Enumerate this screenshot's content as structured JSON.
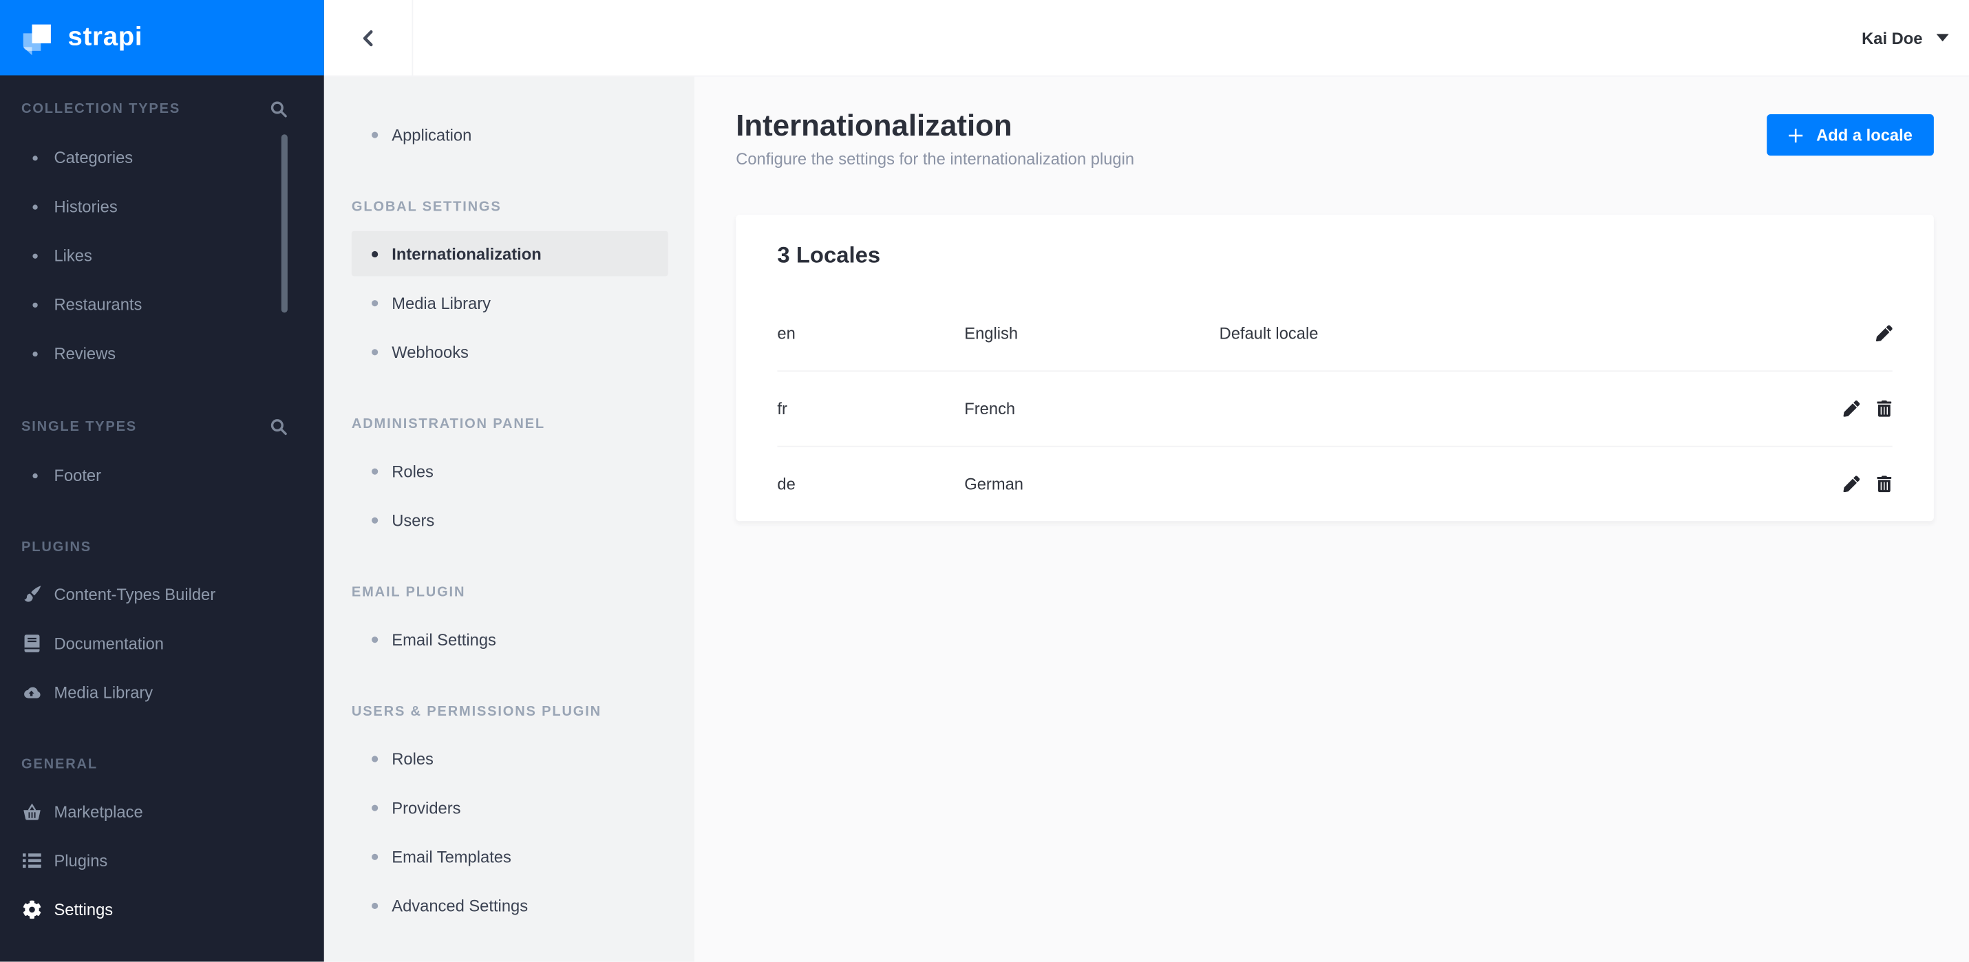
{
  "brand": {
    "logo_text": "strapi",
    "accent_color": "#007eff"
  },
  "main_sidebar": {
    "sections": [
      {
        "label": "COLLECTION TYPES",
        "has_search": true,
        "items": [
          {
            "label": "Categories"
          },
          {
            "label": "Histories"
          },
          {
            "label": "Likes"
          },
          {
            "label": "Restaurants"
          },
          {
            "label": "Reviews"
          }
        ]
      },
      {
        "label": "SINGLE TYPES",
        "has_search": true,
        "items": [
          {
            "label": "Footer"
          }
        ]
      },
      {
        "label": "PLUGINS",
        "items": [
          {
            "label": "Content-Types Builder",
            "icon": "paintbrush-icon"
          },
          {
            "label": "Documentation",
            "icon": "book-icon"
          },
          {
            "label": "Media Library",
            "icon": "cloud-upload-icon"
          }
        ]
      },
      {
        "label": "GENERAL",
        "items": [
          {
            "label": "Marketplace",
            "icon": "basket-icon"
          },
          {
            "label": "Plugins",
            "icon": "list-icon"
          },
          {
            "label": "Settings",
            "icon": "gear-icon",
            "active": true
          }
        ]
      }
    ]
  },
  "top_bar": {
    "user_name": "Kai Doe"
  },
  "settings_nav": {
    "application_item": {
      "label": "Application"
    },
    "sections": [
      {
        "label": "GLOBAL SETTINGS",
        "items": [
          {
            "label": "Internationalization",
            "active": true
          },
          {
            "label": "Media Library"
          },
          {
            "label": "Webhooks"
          }
        ]
      },
      {
        "label": "ADMINISTRATION PANEL",
        "items": [
          {
            "label": "Roles"
          },
          {
            "label": "Users"
          }
        ]
      },
      {
        "label": "EMAIL PLUGIN",
        "items": [
          {
            "label": "Email Settings"
          }
        ]
      },
      {
        "label": "USERS & PERMISSIONS PLUGIN",
        "items": [
          {
            "label": "Roles"
          },
          {
            "label": "Providers"
          },
          {
            "label": "Email Templates"
          },
          {
            "label": "Advanced Settings"
          }
        ]
      }
    ]
  },
  "page": {
    "title": "Internationalization",
    "subtitle": "Configure the settings for the internationalization plugin",
    "add_locale_button": {
      "label": "Add a locale"
    }
  },
  "locales_card": {
    "title": "3 Locales",
    "rows": [
      {
        "code": "en",
        "name": "English",
        "note": "Default locale",
        "actions": [
          "edit"
        ]
      },
      {
        "code": "fr",
        "name": "French",
        "note": "",
        "actions": [
          "edit",
          "delete"
        ]
      },
      {
        "code": "de",
        "name": "German",
        "note": "",
        "actions": [
          "edit",
          "delete"
        ]
      }
    ]
  },
  "icons": [
    "strapi-logo-icon",
    "search-icon",
    "paintbrush-icon",
    "book-icon",
    "cloud-upload-icon",
    "basket-icon",
    "list-icon",
    "gear-icon",
    "chevron-left-icon",
    "caret-down-icon",
    "plus-icon",
    "edit-icon",
    "delete-icon"
  ],
  "colors": {
    "accent_blue": "#007eff",
    "sidebar_dark_bg": "#1c2130",
    "sidebar_light_bg": "#f2f3f4",
    "highlight_bg": "#e9eaeb",
    "content_bg": "#fafafb",
    "card_bg": "#ffffff"
  }
}
